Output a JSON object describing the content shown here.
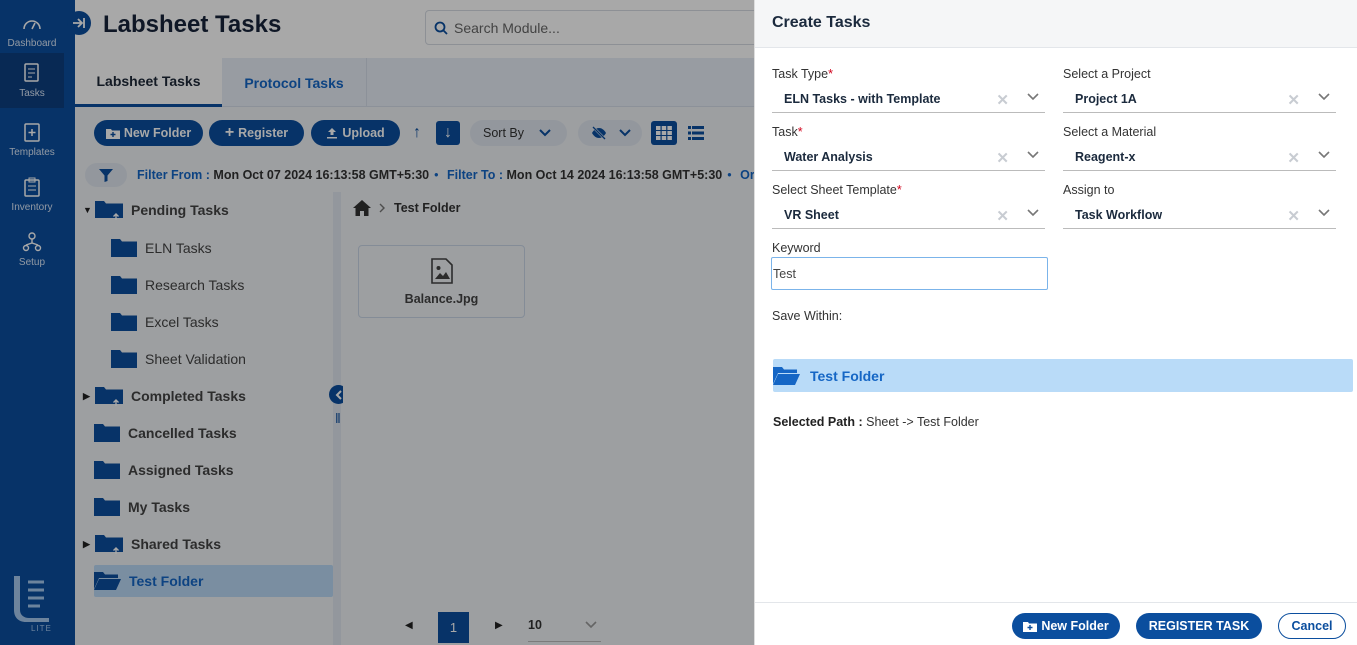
{
  "sidebar": {
    "items": [
      {
        "label": "Dashboard",
        "icon": "dashboard-icon"
      },
      {
        "label": "Tasks",
        "icon": "tasks-icon"
      },
      {
        "label": "Templates",
        "icon": "templates-icon"
      },
      {
        "label": "Inventory",
        "icon": "inventory-icon"
      },
      {
        "label": "Setup",
        "icon": "setup-icon"
      }
    ],
    "active": "Tasks",
    "logo_text": "LITE"
  },
  "header": {
    "title": "Labsheet Tasks",
    "search_placeholder": "Search Module..."
  },
  "tabs": [
    {
      "label": "Labsheet Tasks",
      "active": true
    },
    {
      "label": "Protocol Tasks",
      "active": false
    }
  ],
  "toolbar": {
    "new_folder": "New Folder",
    "register": "Register",
    "upload": "Upload",
    "sort_by": "Sort By"
  },
  "filter": {
    "from_label": "Filter From :",
    "from_value": "Mon Oct 07 2024 16:13:58 GMT+5:30",
    "to_label": "Filter To :",
    "to_value": "Mon Oct 14 2024 16:13:58 GMT+5:30",
    "order_label": "Order T"
  },
  "tree": {
    "pending": "Pending Tasks",
    "children": [
      "ELN Tasks",
      "Research Tasks",
      "Excel Tasks",
      "Sheet Validation"
    ],
    "completed": "Completed Tasks",
    "cancelled": "Cancelled Tasks",
    "assigned": "Assigned Tasks",
    "my": "My Tasks",
    "shared": "Shared Tasks",
    "test": "Test Folder"
  },
  "content": {
    "breadcrumb": "Test Folder",
    "file_name": "Balance.Jpg",
    "page": "1",
    "page_size": "10"
  },
  "panel": {
    "title": "Create Tasks",
    "task_type": {
      "label": "Task Type",
      "value": "ELN Tasks - with Template"
    },
    "task": {
      "label": "Task",
      "value": "Water Analysis"
    },
    "sheet_template": {
      "label": "Select Sheet Template",
      "value": "VR Sheet"
    },
    "project": {
      "label": "Select a Project",
      "value": "Project 1A"
    },
    "material": {
      "label": "Select a Material",
      "value": "Reagent-x"
    },
    "assign_to": {
      "label": "Assign to",
      "value": "Task Workflow"
    },
    "keyword": {
      "label": "Keyword",
      "value": "Test"
    },
    "save_within": "Save Within:",
    "folder": "Test Folder",
    "selected_path_label": "Selected Path :",
    "selected_path_value": "Sheet -> Test Folder",
    "buttons": {
      "new_folder": "New Folder",
      "register": "REGISTER TASK",
      "cancel": "Cancel"
    }
  },
  "colors": {
    "primary": "#0b4e9e",
    "accent": "#1566c5",
    "selected_bg": "#b9dbf8"
  }
}
